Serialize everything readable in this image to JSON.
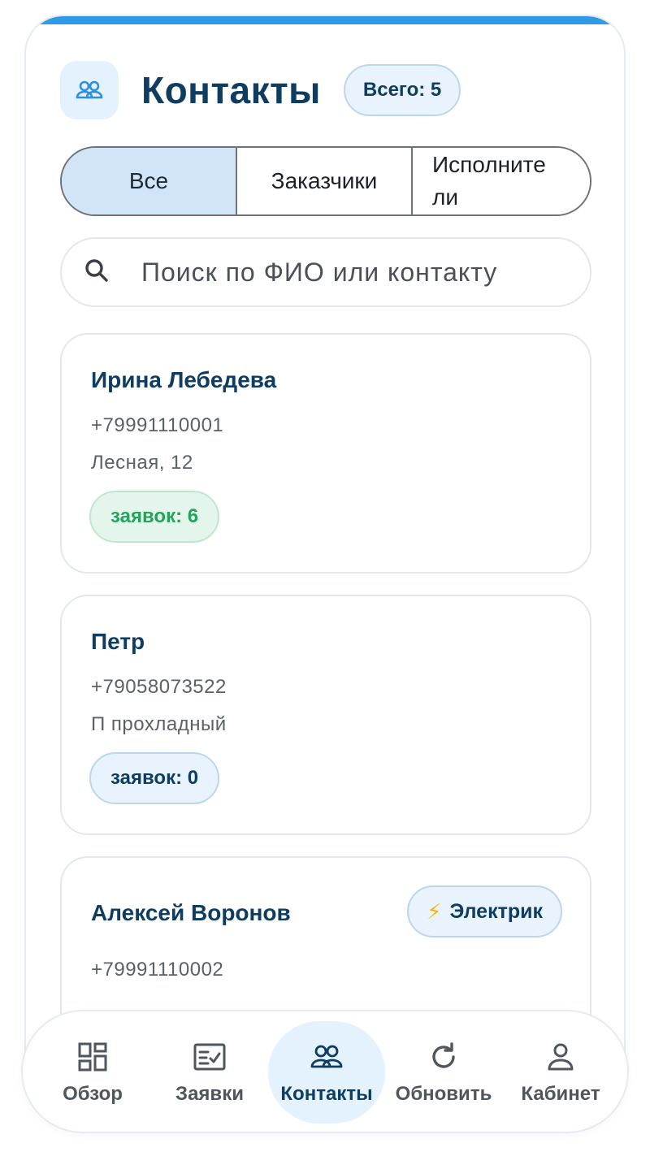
{
  "header": {
    "title": "Контакты",
    "total_badge": "Всего: 5",
    "icon": "people-icon"
  },
  "filter": {
    "segments": [
      {
        "label": "Все",
        "active": true
      },
      {
        "label": "Заказчики",
        "active": false
      },
      {
        "label": "Исполните\nли",
        "active": false
      }
    ]
  },
  "search": {
    "placeholder": "Поиск по ФИО или контакту",
    "value": "",
    "icon": "search-icon"
  },
  "contacts": [
    {
      "name": "Ирина Лебедева",
      "phone": "+79991110001",
      "address": "Лесная, 12",
      "count_label": "заявок: 6"
    },
    {
      "name": "Петр",
      "phone": "+79058073522",
      "address": "П прохладный",
      "count_label": "заявок: 0"
    },
    {
      "name": "Алексей Воронов",
      "phone": "+79991110002",
      "role_icon": "⚡",
      "role_label": "Электрик"
    }
  ],
  "nav": {
    "items": [
      {
        "label": "Обзор",
        "icon": "dashboard-icon"
      },
      {
        "label": "Заявки",
        "icon": "requests-icon"
      },
      {
        "label": "Контакты",
        "icon": "people-icon",
        "active": true
      },
      {
        "label": "Обновить",
        "icon": "refresh-icon"
      },
      {
        "label": "Кабинет",
        "icon": "user-icon"
      }
    ]
  },
  "colors": {
    "accent": "#2f9ae6",
    "title": "#0f3c61",
    "active_bg": "#e3f2fd",
    "success": "#23a35c"
  }
}
